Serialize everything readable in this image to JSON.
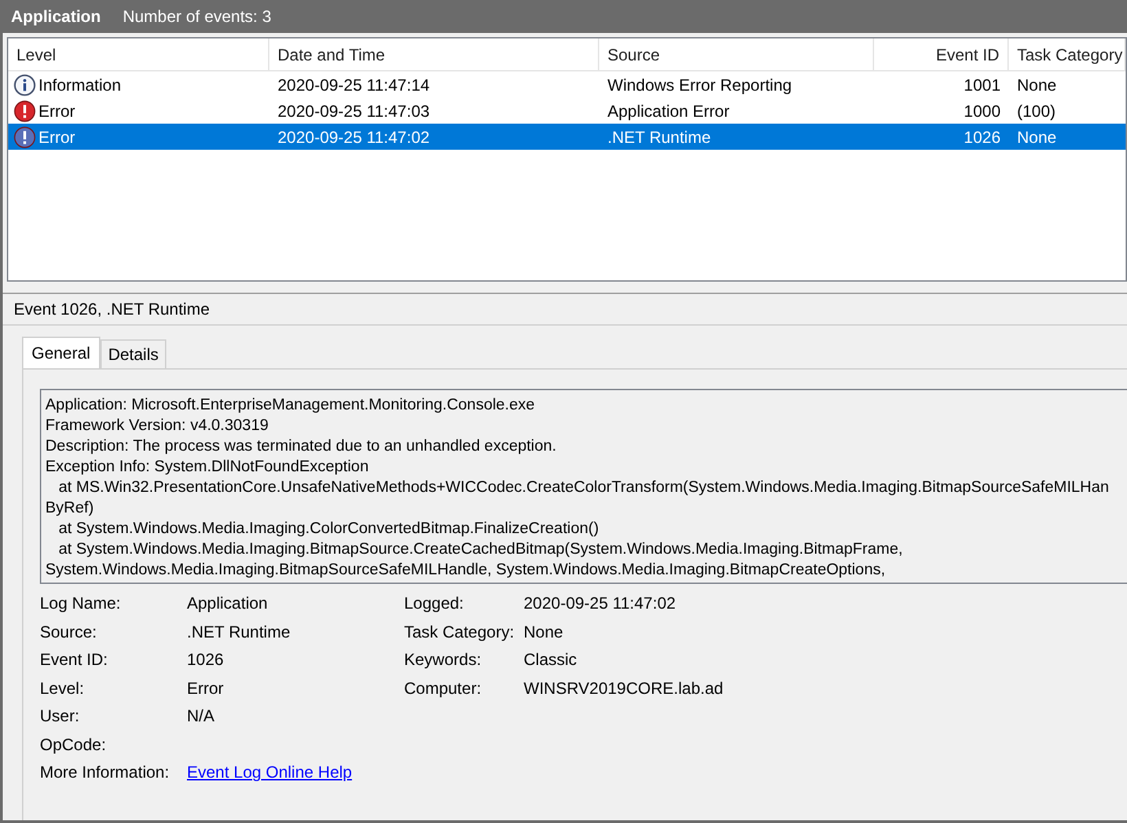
{
  "header": {
    "title": "Application",
    "count": "Number of events: 3"
  },
  "table": {
    "columns": [
      "Level",
      "Date and Time",
      "Source",
      "Event ID",
      "Task Category"
    ],
    "rows": [
      {
        "kind": "info",
        "level": "Information",
        "datetime": "2020-09-25 11:47:14",
        "source": "Windows Error Reporting",
        "event_id": "1001",
        "task_category": "None",
        "selected": false
      },
      {
        "kind": "error",
        "level": "Error",
        "datetime": "2020-09-25 11:47:03",
        "source": "Application Error",
        "event_id": "1000",
        "task_category": "(100)",
        "selected": false
      },
      {
        "kind": "error",
        "level": "Error",
        "datetime": "2020-09-25 11:47:02",
        "source": ".NET Runtime",
        "event_id": "1026",
        "task_category": "None",
        "selected": true
      }
    ]
  },
  "detail": {
    "title": "Event 1026, .NET Runtime",
    "tabs": [
      {
        "label": "General",
        "selected": true
      },
      {
        "label": "Details",
        "selected": false
      }
    ],
    "description_lines": [
      "Application: Microsoft.EnterpriseManagement.Monitoring.Console.exe",
      "Framework Version: v4.0.30319",
      "Description: The process was terminated due to an unhandled exception.",
      "Exception Info: System.DllNotFoundException",
      "   at MS.Win32.PresentationCore.UnsafeNativeMethods+WICCodec.CreateColorTransform(System.Windows.Media.Imaging.BitmapSourceSafeMILHan",
      "ByRef)",
      "   at System.Windows.Media.Imaging.ColorConvertedBitmap.FinalizeCreation()",
      "   at System.Windows.Media.Imaging.BitmapSource.CreateCachedBitmap(System.Windows.Media.Imaging.BitmapFrame,",
      "System.Windows.Media.Imaging.BitmapSourceSafeMILHandle, System.Windows.Media.Imaging.BitmapCreateOptions,"
    ],
    "fields_left": [
      {
        "label": "Log Name:",
        "value": "Application"
      },
      {
        "label": "Source:",
        "value": ".NET Runtime"
      },
      {
        "label": "Event ID:",
        "value": "1026"
      },
      {
        "label": "Level:",
        "value": "Error"
      },
      {
        "label": "User:",
        "value": "N/A"
      },
      {
        "label": "OpCode:"
      }
    ],
    "fields_right": [
      {
        "label": "Logged:",
        "value": "2020-09-25 11:47:02"
      },
      {
        "label": "Task Category:",
        "value": "None"
      },
      {
        "label": "Keywords:",
        "value": "Classic"
      },
      {
        "label": "Computer:",
        "value": "WINSRV2019CORE.lab.ad"
      }
    ],
    "more_info": {
      "label": "More Information:",
      "link": "Event Log Online Help"
    }
  }
}
